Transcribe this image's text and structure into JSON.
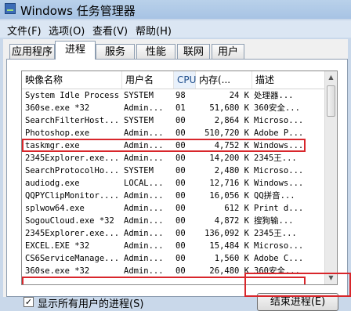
{
  "window": {
    "title": "Windows 任务管理器"
  },
  "menu": [
    "文件(F)",
    "选项(O)",
    "查看(V)",
    "帮助(H)"
  ],
  "tabs": [
    {
      "label": "应用程序",
      "active": false
    },
    {
      "label": "进程",
      "active": true
    },
    {
      "label": "服务",
      "active": false
    },
    {
      "label": "性能",
      "active": false
    },
    {
      "label": "联网",
      "active": false
    },
    {
      "label": "用户",
      "active": false
    }
  ],
  "table": {
    "headers": [
      "映像名称",
      "用户名",
      "CPU",
      "内存(...",
      "描述"
    ],
    "sort_arrow": "^",
    "rows": [
      {
        "name": "System Idle Process",
        "user": "SYSTEM",
        "cpu": "98",
        "mem": "24 K",
        "desc": "处理器..."
      },
      {
        "name": "360se.exe *32",
        "user": "Admin...",
        "cpu": "01",
        "mem": "51,680 K",
        "desc": "360安全..."
      },
      {
        "name": "SearchFilterHost...",
        "user": "SYSTEM",
        "cpu": "00",
        "mem": "2,864 K",
        "desc": "Microso..."
      },
      {
        "name": "Photoshop.exe",
        "user": "Admin...",
        "cpu": "00",
        "mem": "510,720 K",
        "desc": "Adobe P..."
      },
      {
        "name": "taskmgr.exe",
        "user": "Admin...",
        "cpu": "00",
        "mem": "4,752 K",
        "desc": "Windows..."
      },
      {
        "name": "2345Explorer.exe...",
        "user": "Admin...",
        "cpu": "00",
        "mem": "14,200 K",
        "desc": "2345王..."
      },
      {
        "name": "SearchProtocolHo...",
        "user": "SYSTEM",
        "cpu": "00",
        "mem": "2,480 K",
        "desc": "Microso..."
      },
      {
        "name": "audiodg.exe",
        "user": "LOCAL...",
        "cpu": "00",
        "mem": "12,716 K",
        "desc": "Windows..."
      },
      {
        "name": "QQPYClipMonitor....",
        "user": "Admin...",
        "cpu": "00",
        "mem": "16,056 K",
        "desc": "QQ拼音..."
      },
      {
        "name": "splwow64.exe",
        "user": "Admin...",
        "cpu": "00",
        "mem": "612 K",
        "desc": "Print d..."
      },
      {
        "name": "SogouCloud.exe *32",
        "user": "Admin...",
        "cpu": "00",
        "mem": "4,872 K",
        "desc": "搜狗输..."
      },
      {
        "name": "2345Explorer.exe...",
        "user": "Admin...",
        "cpu": "00",
        "mem": "136,092 K",
        "desc": "2345王..."
      },
      {
        "name": "EXCEL.EXE *32",
        "user": "Admin...",
        "cpu": "00",
        "mem": "15,484 K",
        "desc": "Microso..."
      },
      {
        "name": "CS6ServiceManage...",
        "user": "Admin...",
        "cpu": "00",
        "mem": "1,560 K",
        "desc": "Adobe C..."
      },
      {
        "name": "360se.exe *32",
        "user": "Admin...",
        "cpu": "00",
        "mem": "26,480 K",
        "desc": "360安全..."
      }
    ]
  },
  "footer": {
    "show_all_label": "显示所有用户的进程(S)",
    "show_all_checked": true,
    "end_process_label": "结束进程(E)"
  },
  "highlights": [
    "Photoshop.exe",
    "CS6ServiceManage...",
    "结束进程(E)"
  ],
  "colors": {
    "highlight": "#d8262b",
    "titlebar": "#b9d1ea"
  }
}
